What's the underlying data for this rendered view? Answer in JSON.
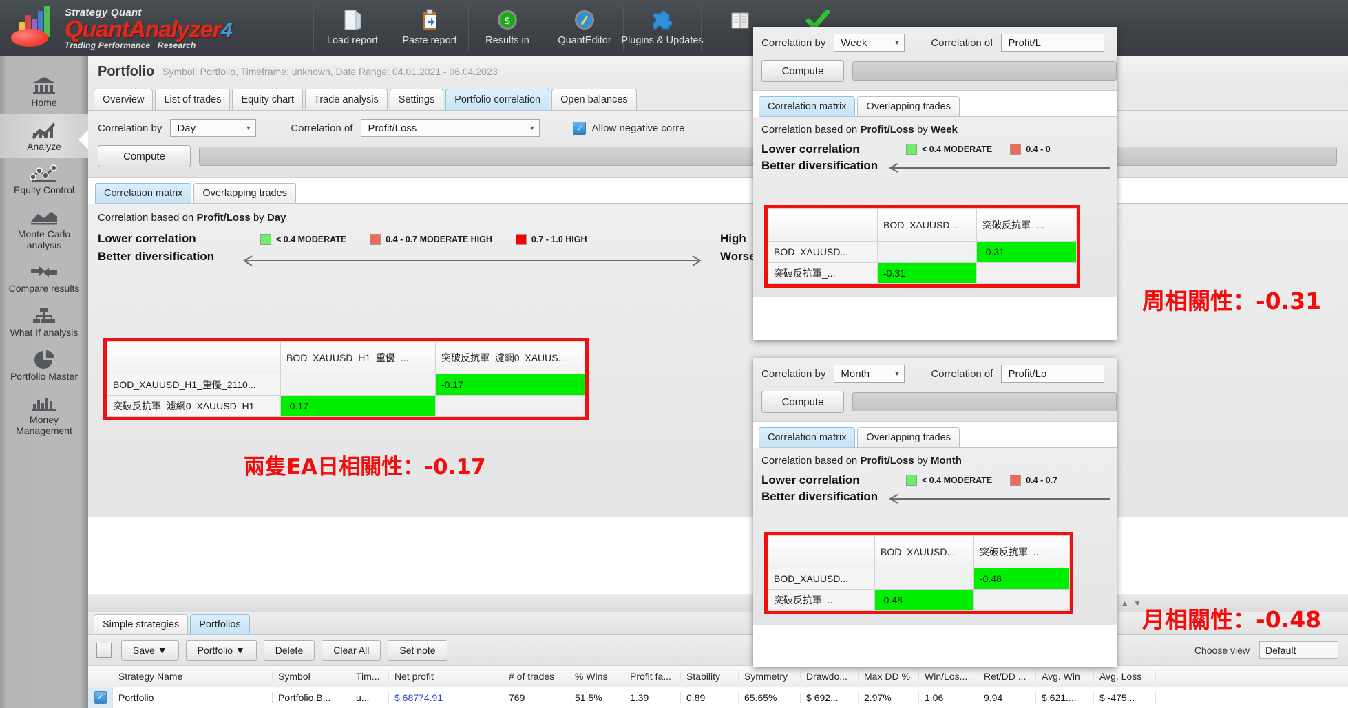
{
  "app": {
    "brand_line1": "Strategy Quant",
    "brand_line2": "QuantAnalyzer",
    "brand_version": "4",
    "brand_line3a": "Trading Performance",
    "brand_line3b": "Research"
  },
  "toolbar": {
    "buttons": [
      {
        "label": "Load report",
        "icon": "folder-icon"
      },
      {
        "label": "Paste report",
        "icon": "clipboard-icon"
      },
      {
        "label": "Results in",
        "icon": "dollar-circle-icon"
      },
      {
        "label": "QuantEditor",
        "icon": "compass-icon"
      },
      {
        "label": "Plugins & Updates",
        "icon": "puzzle-icon"
      },
      {
        "label": "",
        "icon": "book-icon"
      },
      {
        "label": "",
        "icon": "check-icon"
      }
    ]
  },
  "sidebar": {
    "items": [
      {
        "label": "Home",
        "icon": "bank-icon",
        "active": false
      },
      {
        "label": "Analyze",
        "icon": "chart-up-icon",
        "active": true
      },
      {
        "label": "Equity Control",
        "icon": "scatter-line-icon",
        "active": false
      },
      {
        "label": "Monte Carlo analysis",
        "icon": "area-chart-icon",
        "active": false
      },
      {
        "label": "Compare results",
        "icon": "arrows-icon",
        "active": false
      },
      {
        "label": "What If analysis",
        "icon": "tree-icon",
        "active": false
      },
      {
        "label": "Portfolio Master",
        "icon": "pie-chart-icon",
        "active": false
      },
      {
        "label": "Money Management",
        "icon": "bars-icon",
        "active": false
      }
    ]
  },
  "header": {
    "title": "Portfolio",
    "subtitle": "Symbol: Portfolio, Timeframe: unknown, Date Range: 04.01.2021 - 06.04.2023"
  },
  "tabs": [
    {
      "label": "Overview",
      "selected": false
    },
    {
      "label": "List of trades",
      "selected": false
    },
    {
      "label": "Equity chart",
      "selected": false
    },
    {
      "label": "Trade analysis",
      "selected": false
    },
    {
      "label": "Settings",
      "selected": false
    },
    {
      "label": "Portfolio correlation",
      "selected": true
    },
    {
      "label": "Open balances",
      "selected": false
    }
  ],
  "day_panel": {
    "correlation_by_label": "Correlation by",
    "correlation_by_value": "Day",
    "correlation_of_label": "Correlation of",
    "correlation_of_value": "Profit/Loss",
    "allow_negative_label": "Allow negative corre",
    "compute_label": "Compute",
    "subtabs": [
      {
        "label": "Correlation matrix",
        "selected": true
      },
      {
        "label": "Overlapping trades",
        "selected": false
      }
    ],
    "basis_prefix": "Correlation based on ",
    "basis_metric": "Profit/Loss",
    "basis_mid": " by ",
    "basis_period": "Day",
    "legend": {
      "lower": "Lower correlation",
      "better": "Better diversification",
      "higher": "High",
      "worse": "Worse diversification",
      "items": [
        {
          "text": "< 0.4 MODERATE",
          "color": "#6cf06c"
        },
        {
          "text": "0.4 - 0.7 MODERATE HIGH",
          "color": "#f06a5a"
        },
        {
          "text": "0.7 - 1.0 HIGH",
          "color": "#fb0000"
        }
      ]
    },
    "matrix": {
      "columns": [
        "",
        "BOD_XAUUSD_H1_重優_...",
        "突破反抗軍_濾網0_XAUUS..."
      ],
      "rows": [
        {
          "name": "BOD_XAUUSD_H1_重優_2110...",
          "values": [
            "",
            "-0.17"
          ]
        },
        {
          "name": "突破反抗軍_濾網0_XAUUSD_H1",
          "values": [
            "-0.17",
            ""
          ]
        }
      ]
    },
    "annotation": "兩隻EA日相關性：-0.17"
  },
  "week_panel": {
    "correlation_by_label": "Correlation by",
    "correlation_by_value": "Week",
    "correlation_of_label": "Correlation of",
    "correlation_of_value": "Profit/L",
    "compute_label": "Compute",
    "subtabs": [
      {
        "label": "Correlation matrix",
        "selected": true
      },
      {
        "label": "Overlapping trades",
        "selected": false
      }
    ],
    "basis_prefix": "Correlation based on ",
    "basis_metric": "Profit/Loss",
    "basis_mid": " by ",
    "basis_period": "Week",
    "legend": {
      "lower": "Lower correlation",
      "better": "Better diversification",
      "items": [
        {
          "text": "< 0.4 MODERATE",
          "color": "#6cf06c"
        },
        {
          "text": "0.4 - 0",
          "color": "#f06a5a"
        }
      ]
    },
    "matrix": {
      "columns": [
        "",
        "BOD_XAUUSD...",
        "突破反抗軍_..."
      ],
      "rows": [
        {
          "name": "BOD_XAUUSD...",
          "values": [
            "",
            "-0.31"
          ]
        },
        {
          "name": "突破反抗軍_...",
          "values": [
            "-0.31",
            ""
          ]
        }
      ]
    },
    "annotation": "周相關性：-0.31"
  },
  "month_panel": {
    "correlation_by_label": "Correlation by",
    "correlation_by_value": "Month",
    "correlation_of_label": "Correlation of",
    "correlation_of_value": "Profit/Lo",
    "compute_label": "Compute",
    "subtabs": [
      {
        "label": "Correlation matrix",
        "selected": true
      },
      {
        "label": "Overlapping trades",
        "selected": false
      }
    ],
    "basis_prefix": "Correlation based on ",
    "basis_metric": "Profit/Loss",
    "basis_mid": " by ",
    "basis_period": "Month",
    "legend": {
      "lower": "Lower correlation",
      "better": "Better diversification",
      "items": [
        {
          "text": "< 0.4 MODERATE",
          "color": "#6cf06c"
        },
        {
          "text": "0.4 - 0.7",
          "color": "#f06a5a"
        }
      ]
    },
    "matrix": {
      "columns": [
        "",
        "BOD_XAUUSD...",
        "突破反抗軍_..."
      ],
      "rows": [
        {
          "name": "BOD_XAUUSD...",
          "values": [
            "",
            "-0.48"
          ]
        },
        {
          "name": "突破反抗軍_...",
          "values": [
            "-0.48",
            ""
          ]
        }
      ]
    },
    "annotation": "月相關性：-0.48"
  },
  "bottom": {
    "tabs": [
      {
        "label": "Simple strategies",
        "selected": false
      },
      {
        "label": "Portfolios",
        "selected": true
      }
    ],
    "buttons": [
      {
        "label": "Save ▼"
      },
      {
        "label": "Portfolio ▼"
      },
      {
        "label": "Delete"
      },
      {
        "label": "Clear All"
      },
      {
        "label": "Set note"
      }
    ],
    "choose_view_label": "Choose view",
    "choose_view_value": "Default",
    "grid": {
      "columns": [
        "Strategy Name",
        "Symbol",
        "Tim...",
        "Net profit",
        "# of trades",
        "% Wins",
        "Profit fa...",
        "Stability",
        "Symmetry",
        "Drawdo...",
        "Max DD %",
        "Win/Los...",
        "Ret/DD ...",
        "Avg. Win",
        "Avg. Loss"
      ],
      "rows": [
        {
          "checked": true,
          "cells": [
            "Portfolio",
            "Portfolio,B...",
            "u...",
            "$ 68774.91",
            "769",
            "51.5%",
            "1.39",
            "0.89",
            "65.65%",
            "$ 692...",
            "2.97%",
            "1.06",
            "9.94",
            "$ 621....",
            "$ -475..."
          ]
        }
      ]
    }
  },
  "colors": {
    "green_cell": "#00ef00",
    "red_outline": "#ee1111",
    "annotation_red": "#f20c0c",
    "net_profit_blue": "#2a3fd0"
  }
}
